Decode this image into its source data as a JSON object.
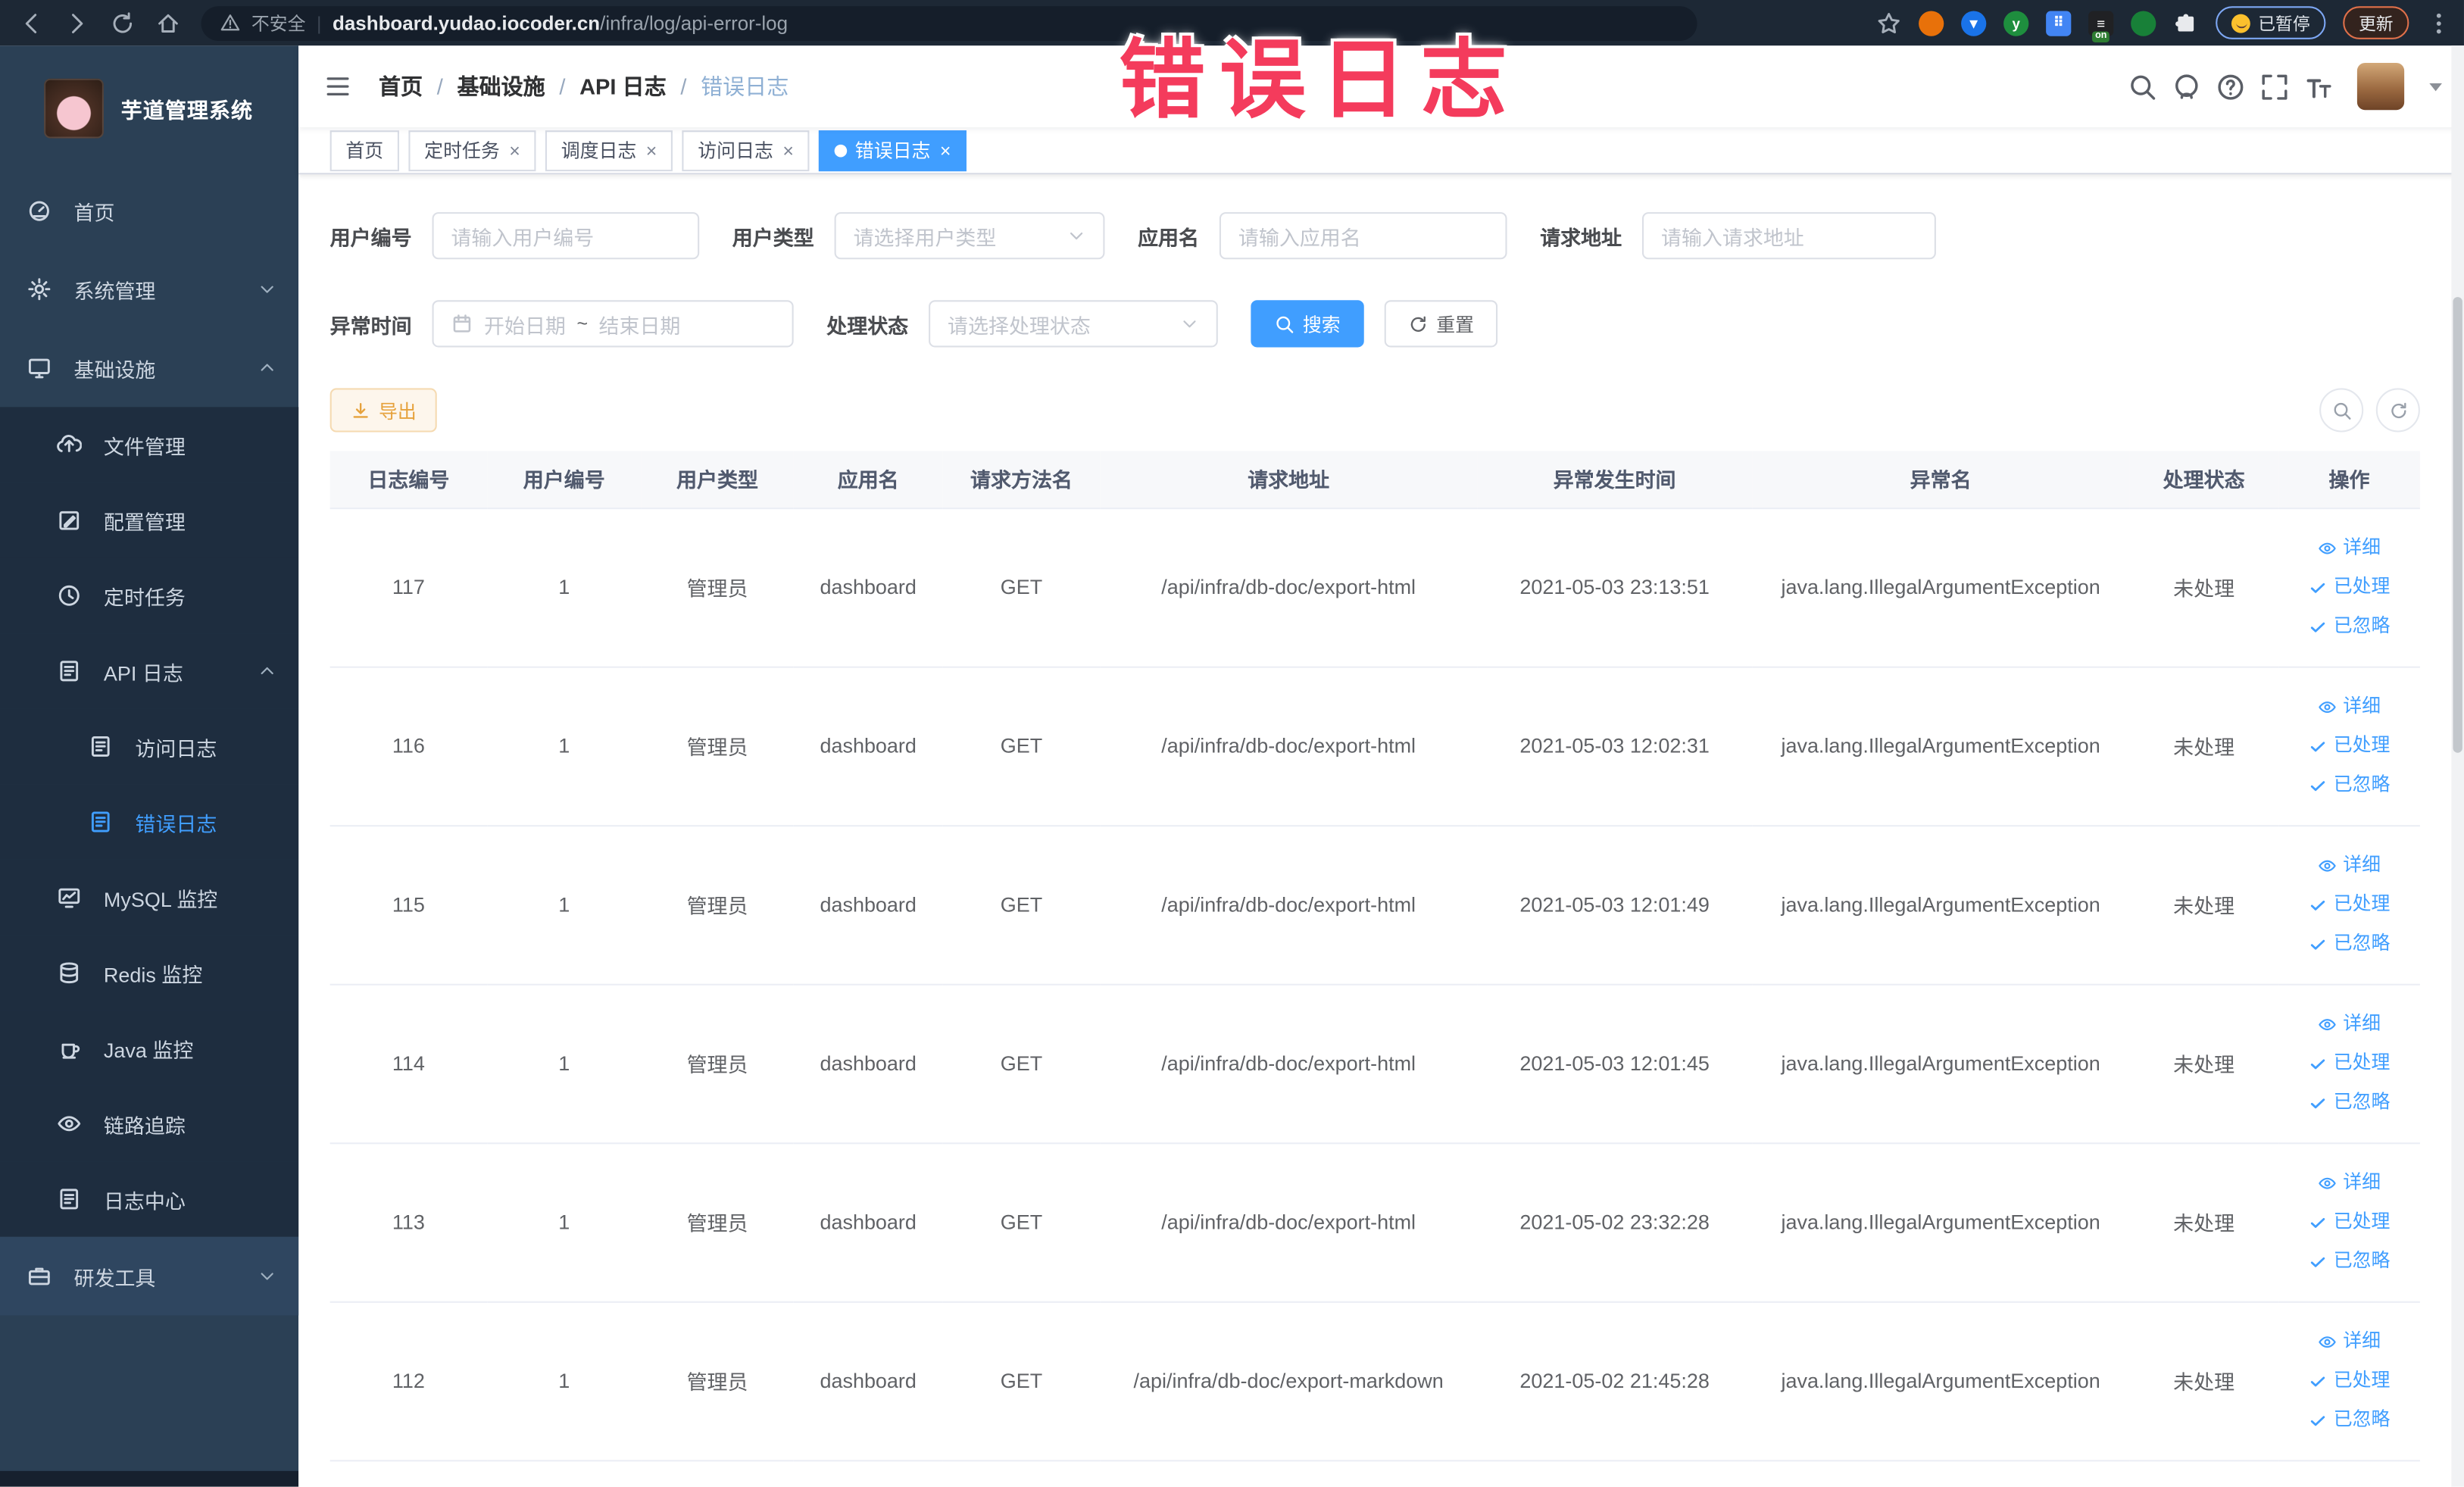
{
  "browser": {
    "security_label": "不安全",
    "url_domain": "dashboard.yudao.iocoder.cn",
    "url_path": "/infra/log/api-error-log",
    "paused_label": "已暂停",
    "update_label": "更新",
    "extensions": [
      {
        "name": "ext-orange-icon",
        "bg": "#e8710a",
        "glyph": "",
        "shape": "circle"
      },
      {
        "name": "ext-location-icon",
        "bg": "#1a73e8",
        "glyph": "▼",
        "shape": "circle"
      },
      {
        "name": "ext-green-y-icon",
        "bg": "#1e8e3e",
        "glyph": "y",
        "shape": "circle"
      },
      {
        "name": "ext-grid-icon",
        "bg": "#4285f4",
        "glyph": "⠿",
        "shape": "square"
      },
      {
        "name": "ext-dark-on-icon",
        "bg": "#202124",
        "glyph": "≡",
        "shape": "square",
        "badge": "on"
      },
      {
        "name": "ext-leaf-icon",
        "bg": "#188038",
        "glyph": "",
        "shape": "circle"
      },
      {
        "name": "ext-puzzle-icon",
        "bg": "#e8eaed",
        "glyph": "",
        "shape": "square"
      }
    ]
  },
  "watermark": "错误日志",
  "sidebar": {
    "title": "芋道管理系统",
    "menu": [
      {
        "label": "首页",
        "icon": "dashboard-icon",
        "level": 0
      },
      {
        "label": "系统管理",
        "icon": "gear-icon",
        "level": 0,
        "chevron": "down"
      },
      {
        "label": "基础设施",
        "icon": "infra-icon",
        "level": 0,
        "chevron": "up"
      },
      {
        "label": "文件管理",
        "icon": "upload-icon",
        "level": 1,
        "sub": true
      },
      {
        "label": "配置管理",
        "icon": "edit-icon",
        "level": 1,
        "sub": true
      },
      {
        "label": "定时任务",
        "icon": "clock-icon",
        "level": 1,
        "sub": true
      },
      {
        "label": "API 日志",
        "icon": "log-icon",
        "level": 1,
        "sub": true,
        "chevron": "up"
      },
      {
        "label": "访问日志",
        "icon": "log-icon",
        "level": 2,
        "sub": true
      },
      {
        "label": "错误日志",
        "icon": "log-icon",
        "level": 2,
        "sub": true,
        "active": true
      },
      {
        "label": "MySQL 监控",
        "icon": "mysql-icon",
        "level": 1,
        "sub": true
      },
      {
        "label": "Redis 监控",
        "icon": "database-icon",
        "level": 1,
        "sub": true
      },
      {
        "label": "Java 监控",
        "icon": "java-icon",
        "level": 1,
        "sub": true
      },
      {
        "label": "链路追踪",
        "icon": "eye-icon",
        "level": 1,
        "sub": true
      },
      {
        "label": "日志中心",
        "icon": "log-icon",
        "level": 1,
        "sub": true
      },
      {
        "label": "研发工具",
        "icon": "toolbox-icon",
        "level": 0,
        "chevron": "down",
        "band": true
      }
    ]
  },
  "navbar": {
    "breadcrumb": [
      "首页",
      "基础设施",
      "API 日志",
      "错误日志"
    ],
    "icons": [
      "search-icon",
      "github-icon",
      "question-icon",
      "fullscreen-icon",
      "fontsize-icon"
    ]
  },
  "tabs": [
    {
      "label": "首页",
      "closable": false,
      "active": false
    },
    {
      "label": "定时任务",
      "closable": true,
      "active": false
    },
    {
      "label": "调度日志",
      "closable": true,
      "active": false
    },
    {
      "label": "访问日志",
      "closable": true,
      "active": false
    },
    {
      "label": "错误日志",
      "closable": true,
      "active": true
    }
  ],
  "filters": {
    "row1": [
      {
        "label": "用户编号",
        "placeholder": "请输入用户编号",
        "type": "input"
      },
      {
        "label": "用户类型",
        "placeholder": "请选择用户类型",
        "type": "select"
      },
      {
        "label": "应用名",
        "placeholder": "请输入应用名",
        "type": "input"
      },
      {
        "label": "请求地址",
        "placeholder": "请输入请求地址",
        "type": "input"
      }
    ],
    "time_label": "异常时间",
    "date_start_placeholder": "开始日期",
    "date_separator": "~",
    "date_end_placeholder": "结束日期",
    "status_label": "处理状态",
    "status_placeholder": "请选择处理状态",
    "search_label": "搜索",
    "reset_label": "重置"
  },
  "toolbar": {
    "export_label": "导出"
  },
  "table": {
    "headers": [
      "日志编号",
      "用户编号",
      "用户类型",
      "应用名",
      "请求方法名",
      "请求地址",
      "异常发生时间",
      "异常名",
      "处理状态",
      "操作"
    ],
    "rows": [
      [
        "117",
        "1",
        "管理员",
        "dashboard",
        "GET",
        "/api/infra/db-doc/export-html",
        "2021-05-03 23:13:51",
        "java.lang.IllegalArgumentException",
        "未处理"
      ],
      [
        "116",
        "1",
        "管理员",
        "dashboard",
        "GET",
        "/api/infra/db-doc/export-html",
        "2021-05-03 12:02:31",
        "java.lang.IllegalArgumentException",
        "未处理"
      ],
      [
        "115",
        "1",
        "管理员",
        "dashboard",
        "GET",
        "/api/infra/db-doc/export-html",
        "2021-05-03 12:01:49",
        "java.lang.IllegalArgumentException",
        "未处理"
      ],
      [
        "114",
        "1",
        "管理员",
        "dashboard",
        "GET",
        "/api/infra/db-doc/export-html",
        "2021-05-03 12:01:45",
        "java.lang.IllegalArgumentException",
        "未处理"
      ],
      [
        "113",
        "1",
        "管理员",
        "dashboard",
        "GET",
        "/api/infra/db-doc/export-html",
        "2021-05-02 23:32:28",
        "java.lang.IllegalArgumentException",
        "未处理"
      ],
      [
        "112",
        "1",
        "管理员",
        "dashboard",
        "GET",
        "/api/infra/db-doc/export-markdown",
        "2021-05-02 21:45:28",
        "java.lang.IllegalArgumentException",
        "未处理"
      ]
    ],
    "row_actions": [
      {
        "label": "详细",
        "icon": "eye-icon"
      },
      {
        "label": "已处理",
        "icon": "check-icon"
      },
      {
        "label": "已忽略",
        "icon": "check-icon"
      }
    ]
  },
  "colors": {
    "primary": "#409eff",
    "warning": "#e6a23c",
    "watermark": "#f43b5c",
    "sidebar_bg": "#2b4055",
    "submenu_bg": "#1e2d3f",
    "browser_bar_bg": "#1d2835",
    "header_row_bg": "#f7f8fa"
  }
}
